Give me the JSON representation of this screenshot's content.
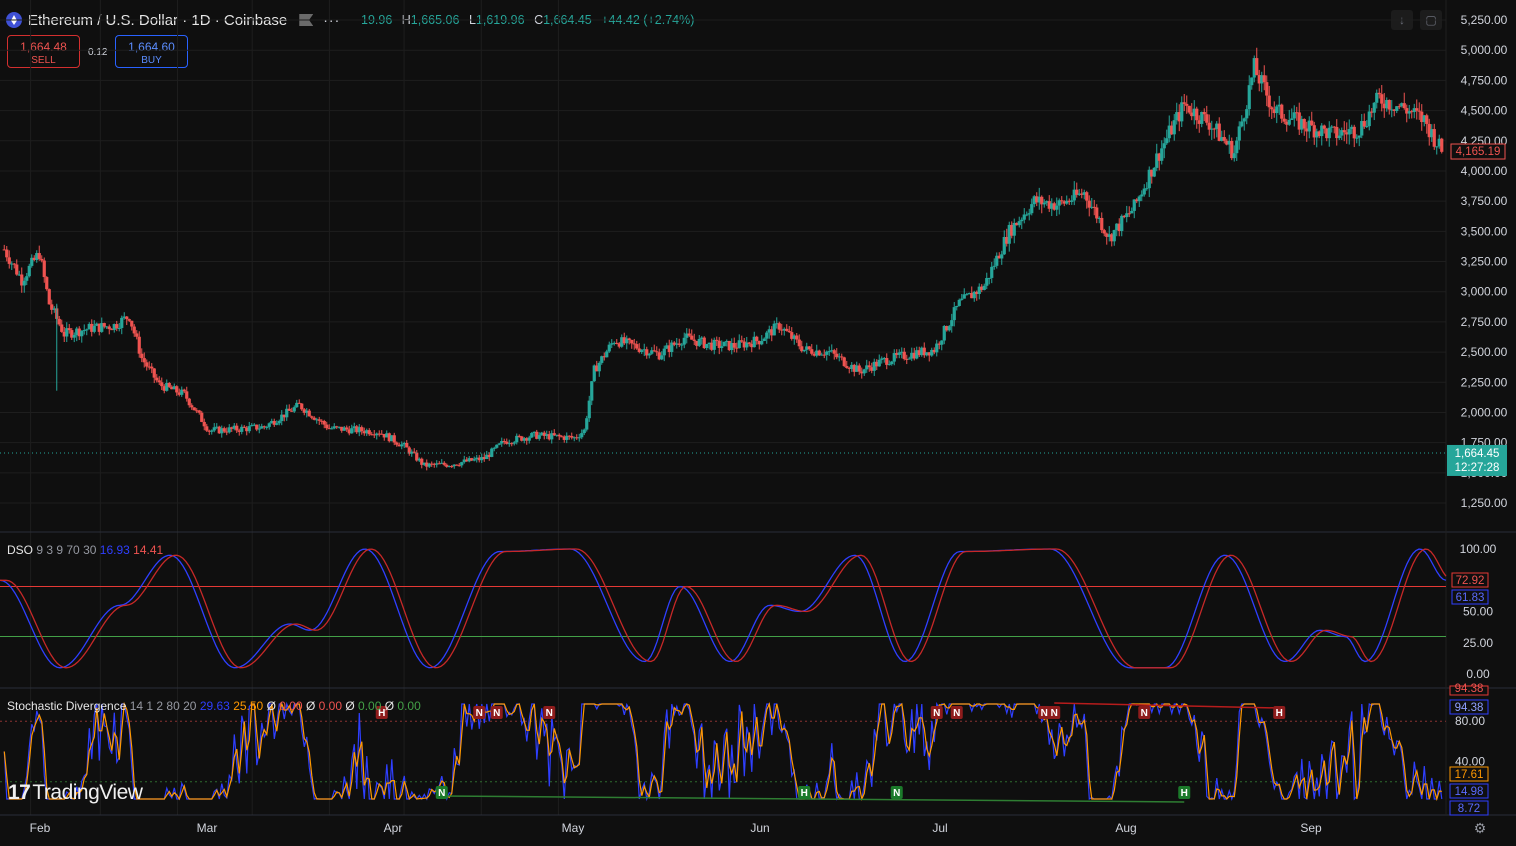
{
  "header": {
    "symbol_title": "Ethereum / U.S. Dollar · 1D · Coinbase",
    "more_label": "···",
    "ohlc": {
      "o_value": "19.96",
      "h_key": "H",
      "h_value": "1,665.06",
      "l_key": "L",
      "l_value": "1,619.96",
      "c_key": "C",
      "c_value": "1,664.45",
      "change": "+44.42 (+2.74%)"
    }
  },
  "trade": {
    "sell_price": "1,664.48",
    "sell_label": "SELL",
    "spread": "0.12",
    "buy_price": "1,664.60",
    "buy_label": "BUY"
  },
  "toolbar": {
    "download_icon": "download-icon",
    "fullscreen_icon": "fullscreen-icon"
  },
  "price_axis": {
    "ticks": [
      "5,250.00",
      "5,000.00",
      "4,750.00",
      "4,500.00",
      "4,250.00",
      "4,000.00",
      "3,750.00",
      "3,500.00",
      "3,250.00",
      "3,000.00",
      "2,750.00",
      "2,500.00",
      "2,250.00",
      "2,000.00",
      "1,750.00",
      "1,500.00",
      "1,250.00"
    ],
    "tick_values": [
      5250,
      5000,
      4750,
      4500,
      4250,
      4000,
      3750,
      3500,
      3250,
      3000,
      2750,
      2500,
      2250,
      2000,
      1750,
      1500,
      1250
    ],
    "hl_label": "4,165.19",
    "last_price_label": "1,664.45",
    "countdown": "12:27:28"
  },
  "time_axis": {
    "labels": [
      "Feb",
      "Mar",
      "Apr",
      "May",
      "Jun",
      "Jul",
      "Aug",
      "Sep"
    ]
  },
  "dso": {
    "name": "DSO",
    "params": "9 3 9 70 30",
    "value_blue": "16.93",
    "value_red": "14.41",
    "axis_ticks": [
      "100.00",
      "50.00",
      "25.00",
      "0.00"
    ],
    "axis_values": [
      100,
      50,
      25,
      0
    ],
    "upper_level": "72.92",
    "blue_current": "61.83",
    "upper_line": 70,
    "lower_line": 30
  },
  "stoch": {
    "name": "Stochastic Divergence",
    "params": "14 1 2 80 20",
    "v1": "29.63",
    "v2": "25.50",
    "v3_sym": "Ø",
    "v3": "0.00",
    "v4_sym": "Ø",
    "v4": "0.00",
    "v5_sym": "Ø",
    "v5": "0.00",
    "v6_sym": "Ø",
    "v6": "0.00",
    "axis_ticks": [
      "80.00",
      "40.00"
    ],
    "axis_values": [
      80,
      40
    ],
    "top_label": "94.38",
    "blue_label": "94.38",
    "orange_label": "17.61",
    "low_blue": "14.98",
    "bottom_label": "8.72",
    "markers": [
      {
        "t": "H",
        "i": 151,
        "kind": "bear"
      },
      {
        "t": "N",
        "i": 190,
        "kind": "bear"
      },
      {
        "t": "N",
        "i": 197,
        "kind": "bear"
      },
      {
        "t": "N",
        "i": 218,
        "kind": "bear"
      },
      {
        "t": "N",
        "i": 373,
        "kind": "bear"
      },
      {
        "t": "N",
        "i": 381,
        "kind": "bear"
      },
      {
        "t": "N",
        "i": 416,
        "kind": "bear"
      },
      {
        "t": "N",
        "i": 420,
        "kind": "bear"
      },
      {
        "t": "N",
        "i": 456,
        "kind": "bear"
      },
      {
        "t": "H",
        "i": 510,
        "kind": "bear"
      },
      {
        "t": "N",
        "i": 175,
        "kind": "bull"
      },
      {
        "t": "H",
        "i": 320,
        "kind": "bull"
      },
      {
        "t": "N",
        "i": 357,
        "kind": "bull"
      },
      {
        "t": "H",
        "i": 472,
        "kind": "bull"
      }
    ]
  },
  "watermark": {
    "logo": "17",
    "text": "TradingView"
  },
  "colors": {
    "up": "#26a69a",
    "down": "#ef5350",
    "blue": "#2f3fff",
    "orange": "#ff9800",
    "red_line": "#e53935",
    "green_line": "#43a047"
  },
  "chart_data": {
    "type": "candlestick",
    "title": "Ethereum / U.S. Dollar · 1D · Coinbase",
    "x_labels": [
      "Feb",
      "Mar",
      "Apr",
      "May",
      "Jun",
      "Jul",
      "Aug",
      "Sep"
    ],
    "ylim": [
      1250,
      5250
    ],
    "monthly_close_estimates": [
      {
        "month": "Feb",
        "close": 2650
      },
      {
        "month": "Mar",
        "close": 1950
      },
      {
        "month": "Apr",
        "close": 1600
      },
      {
        "month": "May",
        "close": 2550
      },
      {
        "month": "Jun",
        "close": 2450
      },
      {
        "month": "Jul",
        "close": 3700
      },
      {
        "month": "Aug",
        "close": 4400
      },
      {
        "month": "Sep",
        "close": 4165
      }
    ],
    "anchors": [
      [
        0,
        3350
      ],
      [
        7,
        3100
      ],
      [
        14,
        3320
      ],
      [
        18,
        2900
      ],
      [
        24,
        2650
      ],
      [
        35,
        2700
      ],
      [
        44,
        2720
      ],
      [
        50,
        2800
      ],
      [
        55,
        2450
      ],
      [
        62,
        2230
      ],
      [
        72,
        2150
      ],
      [
        82,
        1850
      ],
      [
        92,
        1860
      ],
      [
        104,
        1880
      ],
      [
        118,
        2060
      ],
      [
        130,
        1870
      ],
      [
        150,
        1840
      ],
      [
        160,
        1720
      ],
      [
        168,
        1560
      ],
      [
        178,
        1570
      ],
      [
        192,
        1620
      ],
      [
        200,
        1760
      ],
      [
        212,
        1810
      ],
      [
        228,
        1790
      ],
      [
        232,
        1850
      ],
      [
        236,
        2350
      ],
      [
        244,
        2600
      ],
      [
        252,
        2550
      ],
      [
        262,
        2480
      ],
      [
        272,
        2620
      ],
      [
        282,
        2560
      ],
      [
        292,
        2550
      ],
      [
        302,
        2600
      ],
      [
        310,
        2720
      ],
      [
        320,
        2520
      ],
      [
        330,
        2500
      ],
      [
        342,
        2340
      ],
      [
        352,
        2430
      ],
      [
        362,
        2480
      ],
      [
        372,
        2520
      ],
      [
        382,
        2900
      ],
      [
        392,
        3050
      ],
      [
        402,
        3500
      ],
      [
        412,
        3750
      ],
      [
        422,
        3720
      ],
      [
        432,
        3820
      ],
      [
        442,
        3450
      ],
      [
        452,
        3700
      ],
      [
        462,
        4150
      ],
      [
        472,
        4550
      ],
      [
        482,
        4400
      ],
      [
        492,
        4150
      ],
      [
        500,
        4850
      ],
      [
        508,
        4500
      ],
      [
        520,
        4380
      ],
      [
        532,
        4300
      ],
      [
        542,
        4350
      ],
      [
        550,
        4600
      ],
      [
        560,
        4520
      ],
      [
        568,
        4420
      ],
      [
        575,
        4165
      ]
    ],
    "last_price": 1664.45
  }
}
